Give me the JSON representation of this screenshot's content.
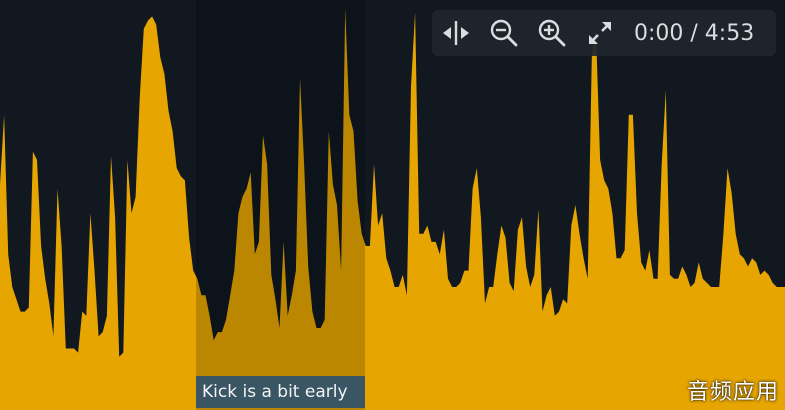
{
  "colors": {
    "background": "#111820",
    "waveform": "#e6a500",
    "region_overlay": "#000000",
    "label_background": "#3a5563",
    "toolbar_background": "#20262c",
    "icon": "#d9dde0"
  },
  "waveform": {
    "samples": [
      0.55,
      0.72,
      0.38,
      0.3,
      0.27,
      0.24,
      0.24,
      0.25,
      0.63,
      0.61,
      0.4,
      0.32,
      0.26,
      0.18,
      0.54,
      0.4,
      0.15,
      0.15,
      0.15,
      0.14,
      0.24,
      0.23,
      0.48,
      0.34,
      0.18,
      0.19,
      0.23,
      0.62,
      0.47,
      0.13,
      0.14,
      0.61,
      0.48,
      0.52,
      0.76,
      0.93,
      0.95,
      0.96,
      0.94,
      0.86,
      0.82,
      0.73,
      0.68,
      0.59,
      0.57,
      0.56,
      0.42,
      0.34,
      0.32,
      0.28,
      0.28,
      0.23,
      0.17,
      0.19,
      0.19,
      0.22,
      0.28,
      0.34,
      0.48,
      0.52,
      0.54,
      0.58,
      0.38,
      0.41,
      0.67,
      0.6,
      0.33,
      0.27,
      0.2,
      0.41,
      0.23,
      0.28,
      0.34,
      0.81,
      0.6,
      0.35,
      0.24,
      0.2,
      0.2,
      0.22,
      0.68,
      0.55,
      0.5,
      0.34,
      0.98,
      0.72,
      0.68,
      0.51,
      0.43,
      0.4,
      0.4,
      0.6,
      0.45,
      0.48,
      0.37,
      0.34,
      0.3,
      0.3,
      0.33,
      0.28,
      0.79,
      0.97,
      0.43,
      0.43,
      0.45,
      0.41,
      0.41,
      0.38,
      0.44,
      0.32,
      0.3,
      0.3,
      0.31,
      0.34,
      0.34,
      0.54,
      0.59,
      0.47,
      0.26,
      0.3,
      0.3,
      0.38,
      0.45,
      0.42,
      0.31,
      0.29,
      0.44,
      0.47,
      0.35,
      0.3,
      0.33,
      0.49,
      0.24,
      0.28,
      0.3,
      0.23,
      0.24,
      0.27,
      0.26,
      0.45,
      0.5,
      0.43,
      0.37,
      0.32,
      0.86,
      0.93,
      0.61,
      0.56,
      0.54,
      0.48,
      0.37,
      0.37,
      0.39,
      0.72,
      0.72,
      0.48,
      0.36,
      0.34,
      0.39,
      0.32,
      0.32,
      0.6,
      0.78,
      0.33,
      0.32,
      0.32,
      0.35,
      0.33,
      0.3,
      0.31,
      0.36,
      0.32,
      0.31,
      0.3,
      0.3,
      0.3,
      0.43,
      0.59,
      0.53,
      0.43,
      0.38,
      0.37,
      0.35,
      0.37,
      0.36,
      0.33,
      0.34,
      0.33,
      0.31,
      0.3,
      0.3,
      0.3
    ]
  },
  "region": {
    "label": "Kick is a bit early",
    "start_fraction": 0.25,
    "end_fraction": 0.465
  },
  "toolbar": {
    "buttons": [
      {
        "name": "split-button",
        "icon": "split-icon"
      },
      {
        "name": "zoom-out-button",
        "icon": "zoom-out-icon"
      },
      {
        "name": "zoom-in-button",
        "icon": "zoom-in-icon"
      },
      {
        "name": "fullscreen-button",
        "icon": "expand-icon"
      }
    ],
    "time": "0:00 / 4:53"
  },
  "watermark": "音频应用"
}
